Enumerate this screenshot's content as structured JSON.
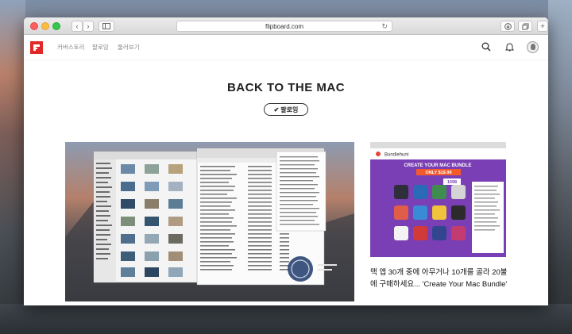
{
  "browser": {
    "url": "flipboard.com"
  },
  "navbar": {
    "links": [
      "커버스토리",
      "팔로잉",
      "둘러보기"
    ]
  },
  "magazine": {
    "title": "BACK TO THE MAC",
    "follow_label": "팔로잉"
  },
  "article_right": {
    "title": "맥 앱 30개 중에 아무거나 10개를 골라 20불에 구매하세요... 'Create Your Mac Bundle'"
  },
  "screenshot2": {
    "brand": "Bundlehunt",
    "heading": "CREATE YOUR MAC BUNDLE",
    "badge": "ONLY $19.99",
    "count": "1098"
  },
  "colors": {
    "brand": "#e12828",
    "bundle_purple": "#7a3fb4",
    "bundle_badge": "#f35a2b"
  }
}
